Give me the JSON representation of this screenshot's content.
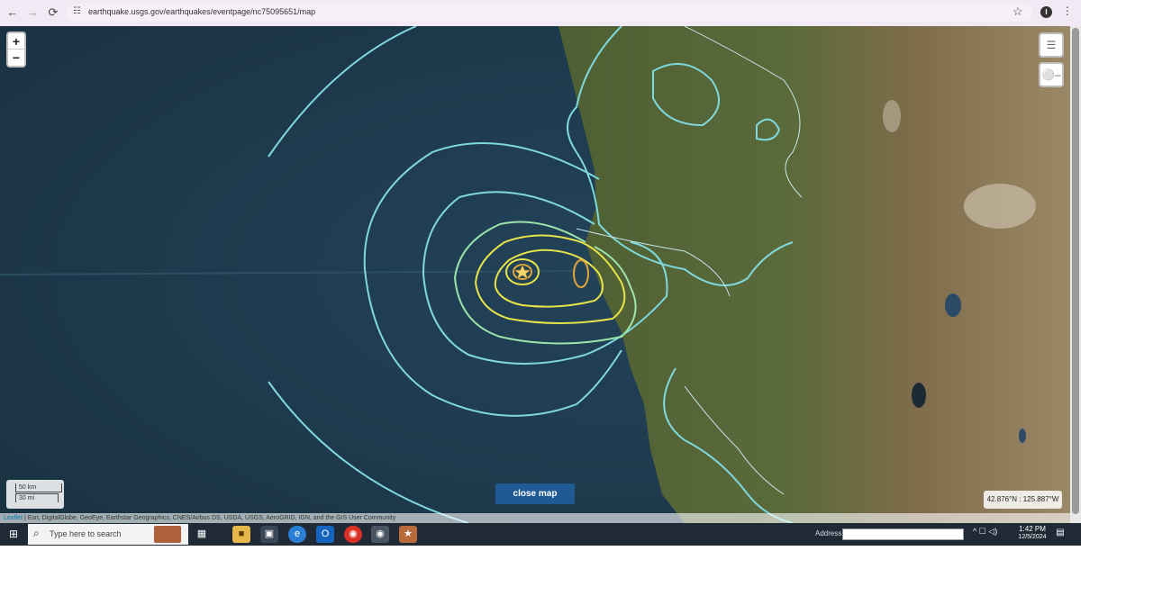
{
  "browser": {
    "back_icon": "←",
    "forward_icon": "→",
    "reload_icon": "⟳",
    "site_info_icon": "☷",
    "url": "earthquake.usgs.gov/earthquakes/eventpage/nc75095651/map",
    "star_icon": "☆",
    "profile_letter": "I",
    "menu_icon": "⋮"
  },
  "map": {
    "zoom_in_label": "+",
    "zoom_out_label": "−",
    "layers_icon": "layers-icon",
    "key_icon": "key-icon",
    "scale_km": "50 km",
    "scale_mi": "30 mi",
    "close_map_label": "close map",
    "coords": "42.876°N : 125.887°W",
    "attribution_leaflet": "Leaflet",
    "attribution_text": " | Esri, DigitalGlobe, GeoEye, Earthstar Geographics, CNES/Airbus DS, USDA, USGS, AeroGRID, IGN, and the GIS User Community",
    "colors": {
      "ocean": "#1f3a4c",
      "land_green": "#4f6034",
      "land_brown": "#8c7252",
      "contour_outer": "#7fd8dc",
      "contour_mid": "#9be3a8",
      "contour_inner": "#e7e44a",
      "contour_core": "#e0a53a"
    }
  },
  "taskbar": {
    "start_icon": "⊞",
    "search_icon": "⌕",
    "search_placeholder": "Type here to search",
    "address_label": "Address",
    "tray_icons": "^ ☐ ◁)",
    "time": "1:42 PM",
    "date": "12/5/2024",
    "notifications_icon": "▤"
  }
}
